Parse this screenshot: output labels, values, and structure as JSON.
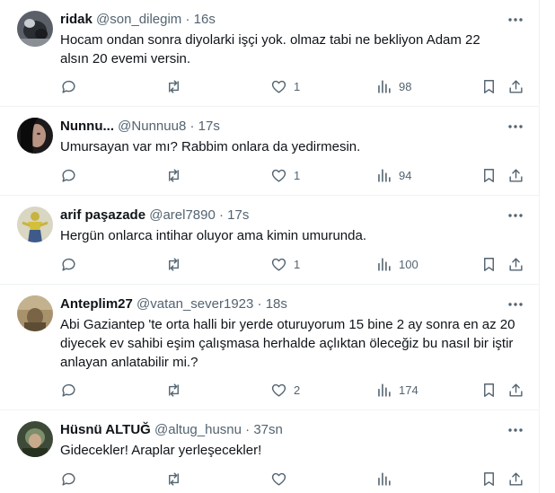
{
  "colors": {
    "text": "#0f1419",
    "secondary": "#536471",
    "divider": "#eff3f4"
  },
  "icons": {
    "reply": "reply-icon",
    "retweet": "retweet-icon",
    "like": "heart-icon",
    "views": "views-chart-icon",
    "bookmark": "bookmark-icon",
    "share": "share-icon",
    "more": "more-dots-icon"
  },
  "tweets": [
    {
      "name": "ridak",
      "handle": "@son_dilegim",
      "separator": "·",
      "time": "16s",
      "text": "Hocam  ondan sonra diyolarki işçi yok. olmaz tabi  ne bekliyon Adam 22\nalsın 20 evemi versin.",
      "likes": "1",
      "views": "98",
      "replies": "",
      "retweets": ""
    },
    {
      "name": "Nunnu...",
      "handle": "@Nunnuu8",
      "separator": "·",
      "time": "17s",
      "text": "Umursayan var mı? Rabbim onlara da yedirmesin.",
      "likes": "1",
      "views": "94",
      "replies": "",
      "retweets": ""
    },
    {
      "name": "arif paşazade",
      "handle": "@arel7890",
      "separator": "·",
      "time": "17s",
      "text": "Hergün onlarca intihar oluyor ama kimin umurunda.",
      "likes": "1",
      "views": "100",
      "replies": "",
      "retweets": ""
    },
    {
      "name": "Anteplim27",
      "handle": "@vatan_sever1923",
      "separator": "·",
      "time": "18s",
      "text": "Abi Gaziantep 'te orta halli bir yerde oturuyorum 15 bine 2 ay sonra en az 20\ndiyecek ev sahibi eşim çalışmasa herhalde açlıktan öleceğiz bu nasıl bir iştir\nanlayan anlatabilir mi.?",
      "likes": "2",
      "views": "174",
      "replies": "",
      "retweets": ""
    },
    {
      "name": "Hüsnü ALTUĞ",
      "handle": "@altug_husnu",
      "separator": "·",
      "time": "37sn",
      "text": "Gidecekler! Araplar yerleşecekler!",
      "likes": "",
      "views": "",
      "replies": "",
      "retweets": ""
    }
  ]
}
